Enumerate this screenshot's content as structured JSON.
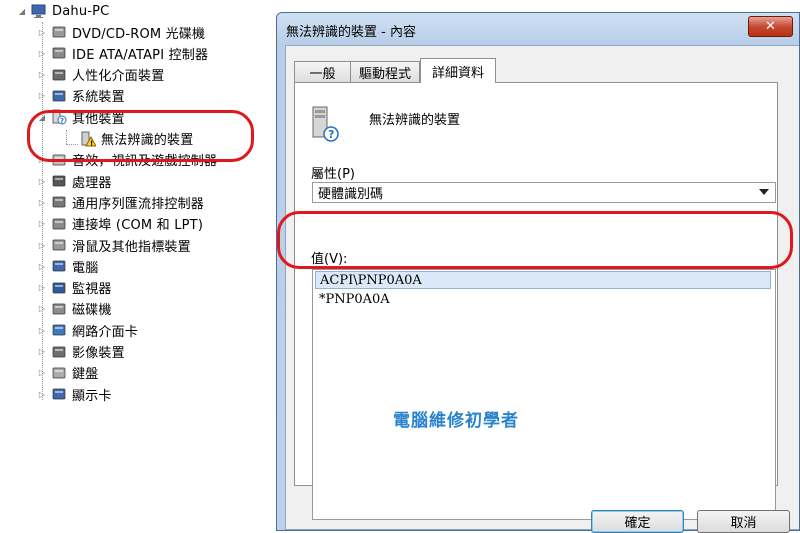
{
  "tree": {
    "root": "Dahu-PC",
    "items": [
      {
        "label": "DVD/CD-ROM 光碟機",
        "icon": "dvd-drive-icon",
        "expanded": false
      },
      {
        "label": "IDE ATA/ATAPI 控制器",
        "icon": "ide-controller-icon",
        "expanded": false
      },
      {
        "label": "人性化介面裝置",
        "icon": "hid-icon",
        "expanded": false
      },
      {
        "label": "系統裝置",
        "icon": "system-device-icon",
        "expanded": false
      },
      {
        "label": "其他裝置",
        "icon": "other-devices-icon",
        "expanded": true
      },
      {
        "label": "無法辨識的裝置",
        "icon": "unknown-device-warning-icon",
        "child": true
      },
      {
        "label": "音效，視訊及遊戲控制器",
        "icon": "audio-icon",
        "expanded": false
      },
      {
        "label": "處理器",
        "icon": "processor-icon",
        "expanded": false
      },
      {
        "label": "通用序列匯流排控制器",
        "icon": "usb-icon",
        "expanded": false
      },
      {
        "label": "連接埠 (COM 和 LPT)",
        "icon": "port-icon",
        "expanded": false
      },
      {
        "label": "滑鼠及其他指標裝置",
        "icon": "mouse-icon",
        "expanded": false
      },
      {
        "label": "電腦",
        "icon": "computer-icon",
        "expanded": false
      },
      {
        "label": "監視器",
        "icon": "monitor-icon",
        "expanded": false
      },
      {
        "label": "磁碟機",
        "icon": "disk-drive-icon",
        "expanded": false
      },
      {
        "label": "網路介面卡",
        "icon": "network-adapter-icon",
        "expanded": false
      },
      {
        "label": "影像裝置",
        "icon": "imaging-device-icon",
        "expanded": false
      },
      {
        "label": "鍵盤",
        "icon": "keyboard-icon",
        "expanded": false
      },
      {
        "label": "顯示卡",
        "icon": "display-adapter-icon",
        "expanded": false
      }
    ]
  },
  "dialog": {
    "title": "無法辨識的裝置 - 內容",
    "close_label": "✕",
    "tabs": [
      {
        "label": "一般",
        "active": false
      },
      {
        "label": "驅動程式",
        "active": false
      },
      {
        "label": "詳細資料",
        "active": true
      }
    ],
    "device_name": "無法辨識的裝置",
    "property_label": "屬性(P)",
    "property_value": "硬體識別碼",
    "value_label": "值(V):",
    "values": [
      {
        "text": "ACPI\\PNP0A0A",
        "selected": true
      },
      {
        "text": "*PNP0A0A",
        "selected": false
      }
    ],
    "watermark": "電腦維修初學者",
    "ok_label": "確定",
    "cancel_label": "取消"
  },
  "colors": {
    "annotation_red": "#e0171f",
    "watermark_blue": "#2a83cf",
    "selection_bg": "#dbe8f7"
  }
}
